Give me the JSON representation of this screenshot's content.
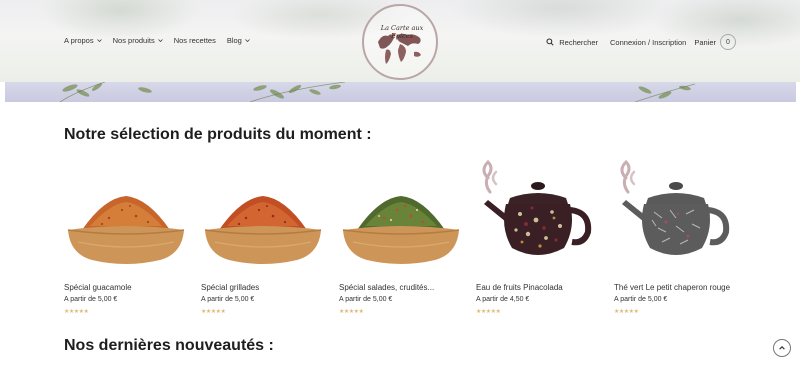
{
  "nav": {
    "items": [
      {
        "label": "A propos",
        "dropdown": true
      },
      {
        "label": "Nos produits",
        "dropdown": true
      },
      {
        "label": "Nos recettes",
        "dropdown": false
      },
      {
        "label": "Blog",
        "dropdown": true
      }
    ],
    "logo_text": "La Carte aux Epices",
    "search_label": "Rechercher",
    "account_label": "Connexion / Inscription",
    "cart_label": "Panier",
    "cart_count": "0"
  },
  "sections": {
    "selection_title": "Notre sélection de produits du moment :",
    "new_title": "Nos dernières nouveautés :"
  },
  "products": [
    {
      "name": "Spécial guacamole",
      "price": "A partir de 5,00 €",
      "rating": "★★★★★",
      "image": "orange-spice-bowl"
    },
    {
      "name": "Spécial grillades",
      "price": "A partir de 5,00 €",
      "rating": "★★★★★",
      "image": "red-spice-bowl"
    },
    {
      "name": "Spécial salades, crudités...",
      "price": "A partir de 5,00 €",
      "rating": "★★★★★",
      "image": "green-herb-bowl"
    },
    {
      "name": "Eau de fruits Pinacolada",
      "price": "A partir de 4,50 €",
      "rating": "★★★★★",
      "image": "fruit-teapot"
    },
    {
      "name": "Thé vert Le petit chaperon rouge",
      "price": "A partir de 5,00 €",
      "rating": "★★★★★",
      "image": "green-tea-teapot"
    }
  ],
  "colors": {
    "rating": "#e0b97a",
    "banner": "#c9c9e0"
  }
}
